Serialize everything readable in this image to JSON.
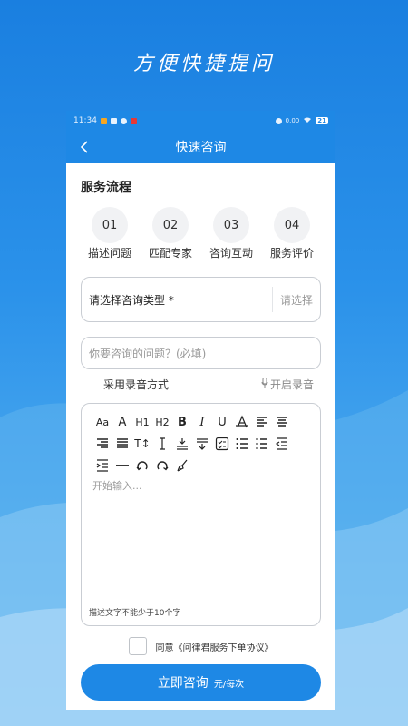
{
  "slogan": "方便快捷提问",
  "status_bar": {
    "time": "11:34",
    "battery": "21",
    "signal_text": "0.00"
  },
  "nav": {
    "title": "快速咨询"
  },
  "service_flow": {
    "title": "服务流程",
    "steps": [
      {
        "num": "01",
        "label": "描述问题"
      },
      {
        "num": "02",
        "label": "匹配专家"
      },
      {
        "num": "03",
        "label": "咨询互动"
      },
      {
        "num": "04",
        "label": "服务评价"
      }
    ]
  },
  "consult_type": {
    "label": "请选择咨询类型 *",
    "placeholder": "请选择"
  },
  "question": {
    "placeholder": "你要咨询的问题？(必填)"
  },
  "audio": {
    "mode_label": "采用录音方式",
    "record_label": "开启录音"
  },
  "editor": {
    "toolbar": [
      "font-size-icon",
      "font-color-icon",
      "heading-1-icon",
      "heading-2-icon",
      "bold-icon",
      "italic-icon",
      "underline-icon",
      "strikethrough-icon",
      "align-left-icon",
      "align-center-icon",
      "align-right-icon",
      "align-justify-icon",
      "text-size-icon",
      "line-height-icon",
      "align-bottom-icon",
      "align-top-icon",
      "checklist-icon",
      "ordered-list-icon",
      "unordered-list-icon",
      "outdent-icon",
      "indent-icon",
      "horizontal-rule-icon",
      "undo-icon",
      "redo-icon",
      "clear-format-icon"
    ],
    "heading1": "H1",
    "heading2": "H2",
    "bold": "B",
    "italic": "I",
    "underline": "U",
    "font_size": "Aa",
    "font_color": "A",
    "text_size": "T↕",
    "placeholder": "开始输入...",
    "hint": "描述文字不能少于10个字"
  },
  "agreement": {
    "text": "同意《问律君服务下单协议》"
  },
  "submit": {
    "label": "立即咨询",
    "unit": "元/每次"
  },
  "colors": {
    "primary": "#1e88e5",
    "border": "#c9cdd3",
    "step_bg": "#f1f2f4"
  }
}
